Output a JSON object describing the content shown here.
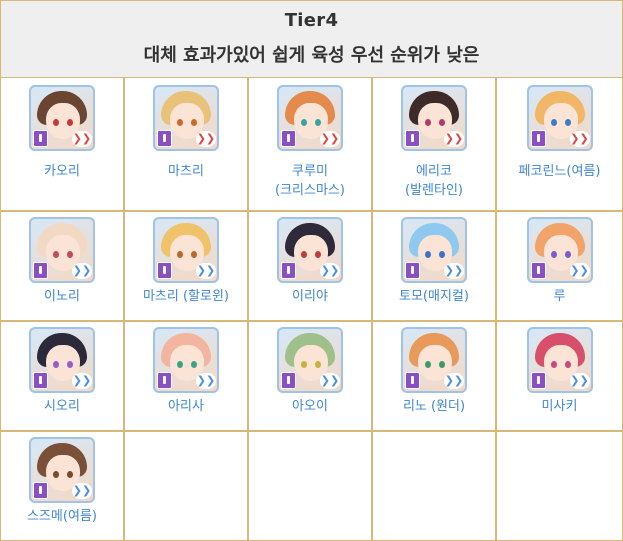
{
  "header": {
    "title": "Tier4",
    "subtitle": "대체 효과가있어 쉽게 육성 우선 순위가 낮은"
  },
  "characters": [
    {
      "name": "카오리",
      "hair": "#6b4532",
      "eye": "#c23b3b",
      "arrow": "red"
    },
    {
      "name": "마츠리",
      "hair": "#e9c27a",
      "eye": "#c96a2a",
      "arrow": "red"
    },
    {
      "name": "쿠루미\n(크리스마스)",
      "hair": "#e48a4c",
      "eye": "#3aa3a0",
      "arrow": "red"
    },
    {
      "name": "에리코\n(발렌타인)",
      "hair": "#3e2a28",
      "eye": "#b33b6b",
      "arrow": "red"
    },
    {
      "name": "페코린느(여름)",
      "hair": "#f2b766",
      "eye": "#3f7cc8",
      "arrow": "red"
    },
    {
      "name": "이노리",
      "hair": "#f2d9c4",
      "eye": "#c44a5a",
      "arrow": "blue"
    },
    {
      "name": "마츠리 (할로윈)",
      "hair": "#f0c26a",
      "eye": "#b86a2a",
      "arrow": "blue"
    },
    {
      "name": "이리야",
      "hair": "#2e2a3a",
      "eye": "#c23a3a",
      "arrow": "blue"
    },
    {
      "name": "토모(매지컬)",
      "hair": "#8fc9ef",
      "eye": "#3a74c7",
      "arrow": "blue"
    },
    {
      "name": "루",
      "hair": "#f1a36a",
      "eye": "#7a5bc9",
      "arrow": "blue"
    },
    {
      "name": "시오리",
      "hair": "#2c2a3a",
      "eye": "#9a5ac8",
      "arrow": "blue"
    },
    {
      "name": "아리사",
      "hair": "#f2b6a0",
      "eye": "#3aa383",
      "arrow": "blue"
    },
    {
      "name": "아오이",
      "hair": "#9fc08a",
      "eye": "#c8b23a",
      "arrow": "blue"
    },
    {
      "name": "리노 (원더)",
      "hair": "#e89a5a",
      "eye": "#3a9a6a",
      "arrow": "blue"
    },
    {
      "name": "미사키",
      "hair": "#d84f6a",
      "eye": "#c84a7a",
      "arrow": "blue"
    },
    {
      "name": "스즈메(여름)",
      "hair": "#7a5138",
      "eye": "#7a4a2a",
      "arrow": "blue"
    }
  ]
}
